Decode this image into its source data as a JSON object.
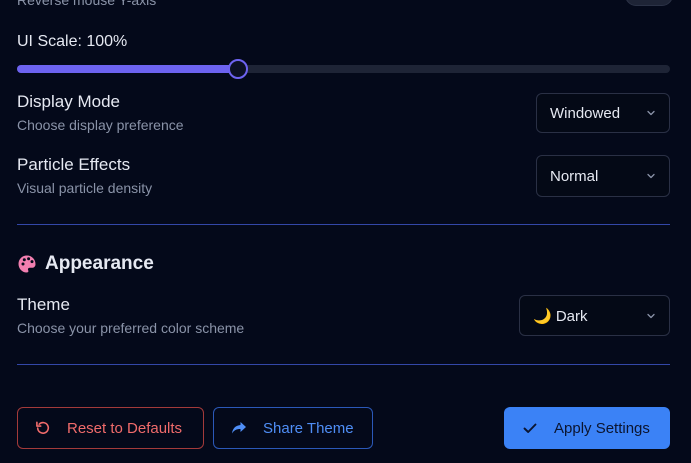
{
  "top_cutoff": {
    "subtitle": "Reverse mouse Y-axis",
    "toggle_on": false
  },
  "ui_scale": {
    "label": "UI Scale: 100%",
    "fill_fraction": 0.338
  },
  "display_mode": {
    "title": "Display Mode",
    "subtitle": "Choose display preference",
    "selected": "Windowed"
  },
  "particle_effects": {
    "title": "Particle Effects",
    "subtitle": "Visual particle density",
    "selected": "Normal"
  },
  "appearance": {
    "section_title": "Appearance",
    "icon": "palette-icon",
    "theme": {
      "title": "Theme",
      "subtitle": "Choose your preferred color scheme",
      "selected": "🌙 Dark"
    }
  },
  "buttons": {
    "reset": "Reset to Defaults",
    "share": "Share Theme",
    "apply": "Apply Settings"
  },
  "colors": {
    "background": "#04091a",
    "accent": "#6d63f0",
    "divider": "#3347a8",
    "reset": "#f06b6b",
    "share": "#4f8ef6",
    "apply_bg": "#3b82f6"
  }
}
